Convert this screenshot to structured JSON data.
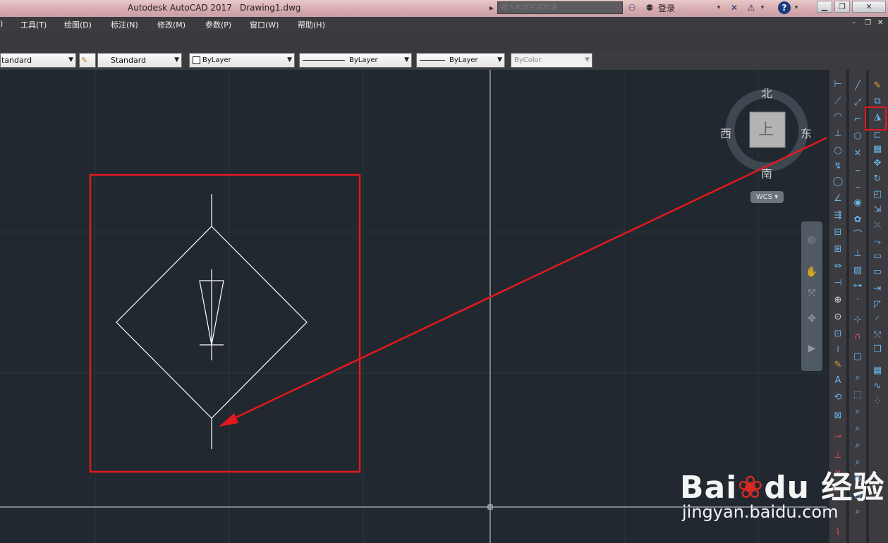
{
  "app_title": "Autodesk AutoCAD 2017",
  "file_name": "Drawing1.dwg",
  "search": {
    "placeholder": "键入关键字或短语"
  },
  "login": {
    "label": "登录"
  },
  "menu": [
    {
      "label": ")"
    },
    {
      "label": "工具(T)"
    },
    {
      "label": "绘图(D)"
    },
    {
      "label": "标注(N)"
    },
    {
      "label": "修改(M)"
    },
    {
      "label": "参数(P)"
    },
    {
      "label": "窗口(W)"
    },
    {
      "label": "帮助(H)"
    }
  ],
  "properties": {
    "text_style": "tandard",
    "dim_style": "Standard",
    "color": "ByLayer",
    "linetype": "ByLayer",
    "lineweight": "ByLayer",
    "plot_style": "ByColor"
  },
  "viewcube": {
    "north": "北",
    "south": "南",
    "east": "东",
    "west": "西",
    "face": "上",
    "wcs": "WCS"
  },
  "watermark": {
    "brand": "Bai",
    "brand_suffix": "du",
    "brand_cn": "经验",
    "url": "jingyan.baidu.com"
  },
  "colors": {
    "canvas": "#212830",
    "highlight": "#e3191e",
    "drawing_lines": "#ffffff",
    "tool_icon": "#6ab4ea"
  }
}
